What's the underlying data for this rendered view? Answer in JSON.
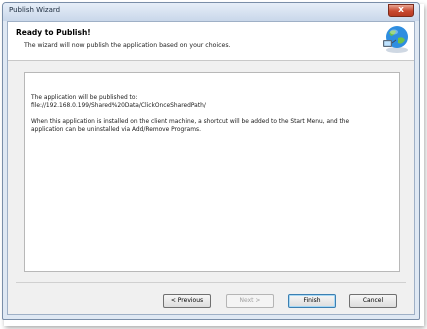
{
  "window": {
    "title": "Publish Wizard",
    "close_glyph": "x"
  },
  "header": {
    "title": "Ready to Publish!",
    "subtitle": "The wizard will now publish the application based on your choices.",
    "icon": "globe-network-icon"
  },
  "content": {
    "line1": "The application will be published to:",
    "line2": "file://192.168.0.199/Shared%20Data/ClickOnceSharedPath/",
    "line3": "When this application is installed on the client machine, a shortcut will be added to the Start Menu, and the",
    "line4": "application can be uninstalled via Add/Remove Programs."
  },
  "buttons": {
    "previous": "< Previous",
    "next": "Next >",
    "finish": "Finish",
    "cancel": "Cancel"
  },
  "colors": {
    "accent": "#3c7fb1",
    "close_red": "#c8482f"
  }
}
